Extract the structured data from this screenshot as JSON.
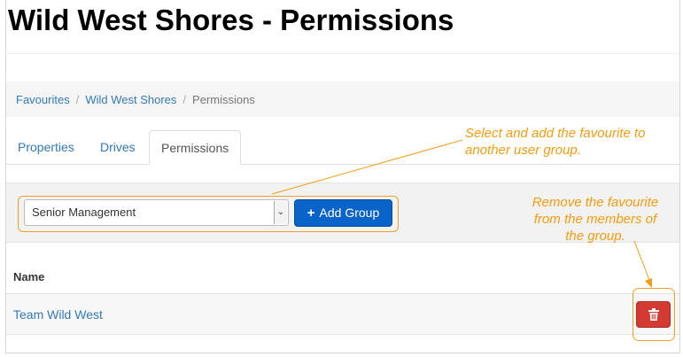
{
  "page": {
    "title": "Wild West Shores - Permissions"
  },
  "breadcrumb": {
    "items": [
      {
        "label": "Favourites"
      },
      {
        "label": "Wild West Shores"
      },
      {
        "label": "Permissions"
      }
    ],
    "separator": "/"
  },
  "tabs": [
    {
      "label": "Properties",
      "active": false
    },
    {
      "label": "Drives",
      "active": false
    },
    {
      "label": "Permissions",
      "active": true
    }
  ],
  "toolbar": {
    "group_select_value": "Senior Management",
    "add_group_label": "Add Group",
    "add_icon": "plus-icon"
  },
  "table": {
    "header": "Name",
    "rows": [
      {
        "name": "Team Wild West",
        "action_icon": "trash-icon"
      }
    ]
  },
  "annotations": {
    "add_hint": "Select and add the favourite to another user group.",
    "remove_hint_line1": "Remove the favourite",
    "remove_hint_line2": "from the members of",
    "remove_hint_line3": "the group."
  },
  "colors": {
    "link": "#337ab7",
    "primary_button": "#0a63c8",
    "danger_button": "#d23a32",
    "annotation": "#f39c12"
  }
}
